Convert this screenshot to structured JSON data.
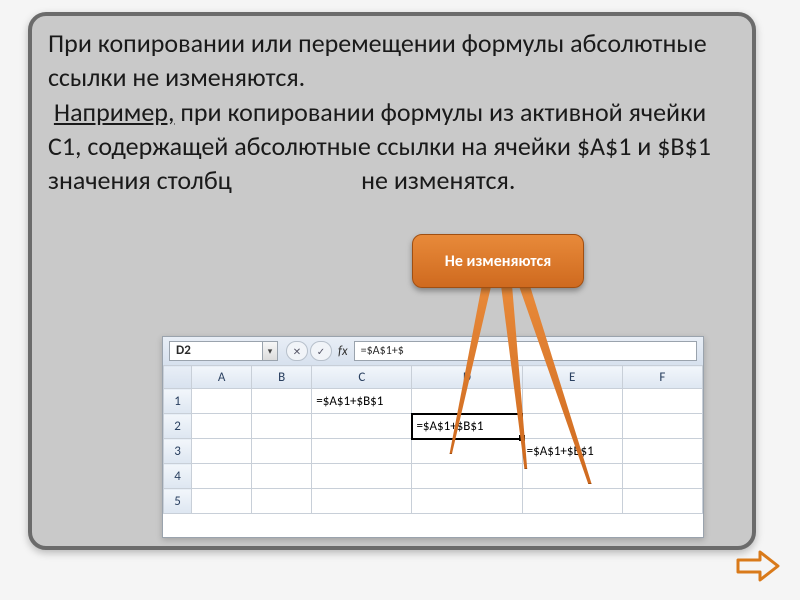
{
  "text": {
    "p1": "При копировании или перемещении формулы абсолютные ссылки не изменяются.",
    "example_word": "Например,",
    "p2_rest": " при  копировании формулы из активной ячейки С1, содержащей абсолютные ссылки на ячейки $A$1  и  $B$1 значения столбц",
    "p2_tail": "не изменятся."
  },
  "callout": {
    "label": "Не изменяются"
  },
  "excel": {
    "name_box": "D2",
    "fx_label": "fx",
    "formula_bar": "=$A$1+$",
    "columns": [
      "A",
      "B",
      "C",
      "D",
      "E",
      "F"
    ],
    "rows": [
      "1",
      "2",
      "3",
      "4",
      "5"
    ],
    "cells": {
      "C1": "=$A$1+$B$1",
      "D2": "=$A$1+$B$1",
      "E3": "=$A$1+$B$1"
    },
    "selected": "D2"
  },
  "nav": {
    "next": "next"
  }
}
